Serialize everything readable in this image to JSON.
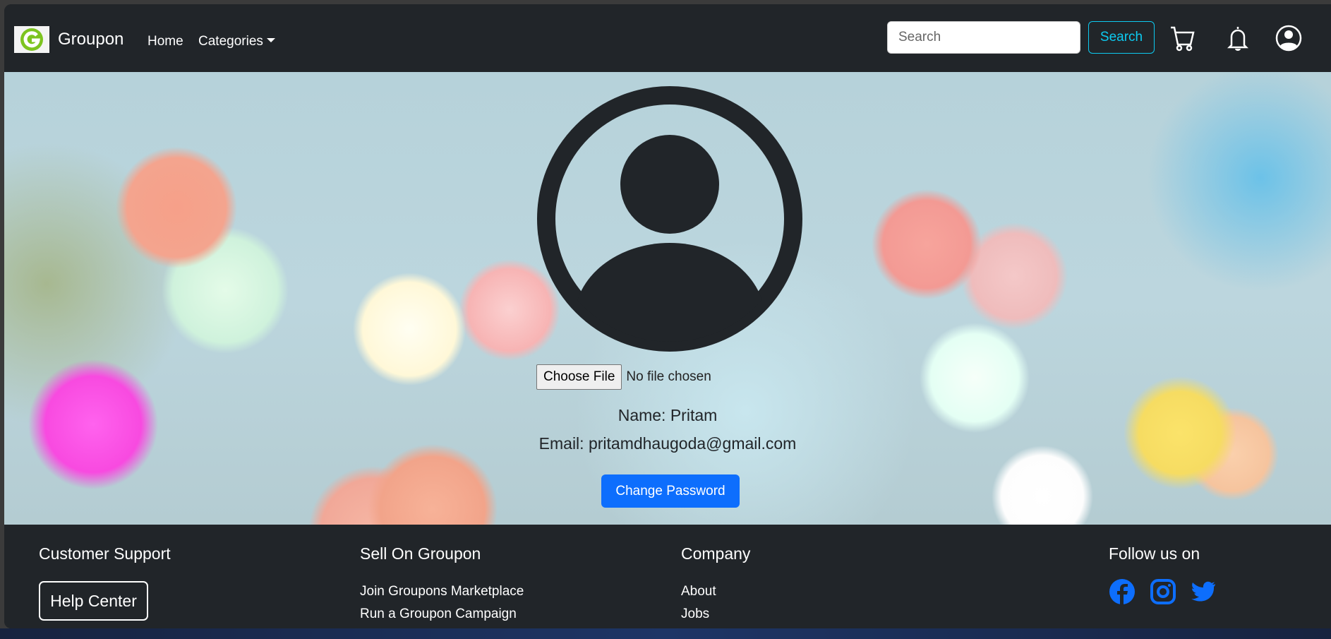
{
  "nav": {
    "brand": "Groupon",
    "logo_letter": "G",
    "links": [
      {
        "label": "Home"
      },
      {
        "label": "Categories"
      }
    ],
    "search_placeholder": "Search",
    "search_button": "Search",
    "icons": [
      "cart-icon",
      "bell-icon",
      "user-circle-icon"
    ]
  },
  "profile": {
    "choose_file": "Choose File",
    "file_status": "No file chosen",
    "name": "Name: Pritam",
    "email": "Email: pritamdhaugoda@gmail.com",
    "change_password": "Change Password"
  },
  "footer": {
    "customer_support": {
      "heading": "Customer Support",
      "help_center": "Help Center"
    },
    "sell": {
      "heading": "Sell On Groupon",
      "links": [
        "Join Groupons Marketplace",
        "Run a Groupon Campaign"
      ]
    },
    "company": {
      "heading": "Company",
      "links": [
        "About",
        "Jobs"
      ]
    },
    "follow": {
      "heading": "Follow us on",
      "icons": [
        "facebook-icon",
        "instagram-icon",
        "twitter-icon"
      ]
    }
  },
  "colors": {
    "navbar": "#212529",
    "search_accent": "#0dcaf0",
    "primary": "#0d6efd",
    "logo_green": "#7dc41f"
  }
}
